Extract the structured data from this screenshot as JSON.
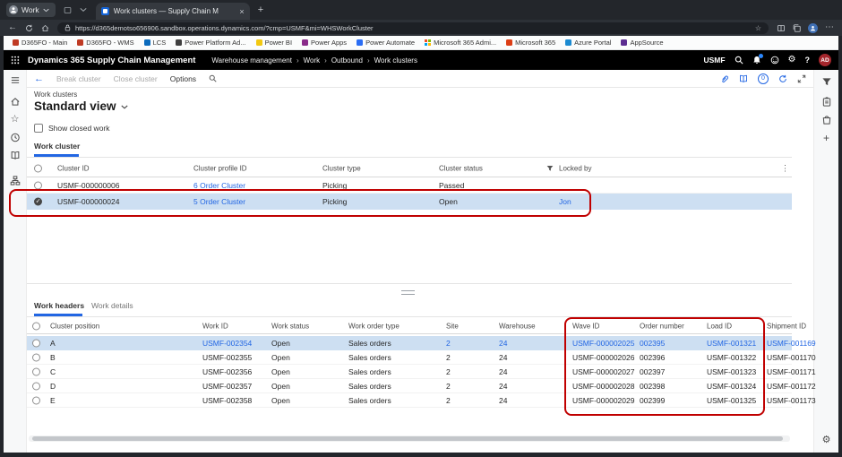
{
  "icons": {
    "back": "←",
    "star": "☆",
    "ellipsis_v": "⋮",
    "ellipsis_h": "⋯",
    "plus": "+",
    "close": "×",
    "check": "✓",
    "breadcrumb_sep": "›",
    "question": "?",
    "gear": "⚙",
    "new_tab": "+"
  },
  "browser": {
    "workspace_label": "Work",
    "tab_title": "Work clusters — Supply Chain M",
    "url": "https://d365demotso656906.sandbox.operations.dynamics.com/?cmp=USMF&mi=WHSWorkCluster",
    "ms_logo": [
      "#f25022",
      "#7fba00",
      "#00a4ef",
      "#ffb900"
    ],
    "bookmarks": [
      {
        "label": "D365FO - Main",
        "color": "#bf3a23"
      },
      {
        "label": "D365FO - WMS",
        "color": "#bf3a23"
      },
      {
        "label": "LCS",
        "color": "#0b6bbd"
      },
      {
        "label": "Power Platform Ad...",
        "color": "#404040"
      },
      {
        "label": "Power BI",
        "color": "#f2c811"
      },
      {
        "label": "Power Apps",
        "color": "#8a2c8a"
      },
      {
        "label": "Power Automate",
        "color": "#2a6df4"
      },
      {
        "label": "Microsoft 365 Admi...",
        "color": ""
      },
      {
        "label": "Microsoft 365",
        "color": "#dc3e15"
      },
      {
        "label": "Azure Portal",
        "color": "#1b8ad1"
      },
      {
        "label": "AppSource",
        "color": "#5c2d91"
      }
    ]
  },
  "app_header": {
    "product_title": "Dynamics 365 Supply Chain Management",
    "breadcrumb": [
      "Warehouse management",
      "Work",
      "Outbound",
      "Work clusters"
    ],
    "company": "USMF",
    "avatar_initials": "AD"
  },
  "action_pane": {
    "break_cluster": "Break cluster",
    "close_cluster": "Close cluster",
    "options": "Options",
    "badge_count": "0"
  },
  "page": {
    "caption": "Work clusters",
    "view_title": "Standard view",
    "show_closed_work": "Show closed work",
    "cluster_tab": "Work cluster",
    "work_headers_tab": "Work headers",
    "work_details_tab": "Work details"
  },
  "cluster_grid": {
    "columns": [
      "Cluster ID",
      "Cluster profile ID",
      "Cluster type",
      "Cluster status",
      "Locked by"
    ],
    "rows": [
      {
        "cluster_id": "USMF-000000006",
        "cluster_profile_id": "6 Order Cluster",
        "cluster_type": "Picking",
        "cluster_status": "Passed",
        "locked_by": ""
      },
      {
        "cluster_id": "USMF-000000024",
        "cluster_profile_id": "5 Order Cluster",
        "cluster_type": "Picking",
        "cluster_status": "Open",
        "locked_by": "Jon"
      }
    ]
  },
  "work_grid": {
    "columns": [
      "Cluster position",
      "Work ID",
      "Work status",
      "Work order type",
      "Site",
      "Warehouse",
      "Wave ID",
      "Order number",
      "Load ID",
      "Shipment ID"
    ],
    "rows": [
      {
        "cluster_position": "A",
        "work_id": "USMF-002354",
        "work_status": "Open",
        "work_order_type": "Sales orders",
        "site": "2",
        "warehouse": "24",
        "wave_id": "USMF-000002025",
        "order_number": "002395",
        "load_id": "USMF-001321",
        "shipment_id": "USMF-001169"
      },
      {
        "cluster_position": "B",
        "work_id": "USMF-002355",
        "work_status": "Open",
        "work_order_type": "Sales orders",
        "site": "2",
        "warehouse": "24",
        "wave_id": "USMF-000002026",
        "order_number": "002396",
        "load_id": "USMF-001322",
        "shipment_id": "USMF-001170"
      },
      {
        "cluster_position": "C",
        "work_id": "USMF-002356",
        "work_status": "Open",
        "work_order_type": "Sales orders",
        "site": "2",
        "warehouse": "24",
        "wave_id": "USMF-000002027",
        "order_number": "002397",
        "load_id": "USMF-001323",
        "shipment_id": "USMF-001171"
      },
      {
        "cluster_position": "D",
        "work_id": "USMF-002357",
        "work_status": "Open",
        "work_order_type": "Sales orders",
        "site": "2",
        "warehouse": "24",
        "wave_id": "USMF-000002028",
        "order_number": "002398",
        "load_id": "USMF-001324",
        "shipment_id": "USMF-001172"
      },
      {
        "cluster_position": "E",
        "work_id": "USMF-002358",
        "work_status": "Open",
        "work_order_type": "Sales orders",
        "site": "2",
        "warehouse": "24",
        "wave_id": "USMF-000002029",
        "order_number": "002399",
        "load_id": "USMF-001325",
        "shipment_id": "USMF-001173"
      }
    ]
  },
  "colors": {
    "accent": "#2266e3",
    "selection": "#cddff2",
    "annotation": "#c00000",
    "avatar_bg": "#a4262c",
    "tab_favicon": "#1565d8"
  }
}
